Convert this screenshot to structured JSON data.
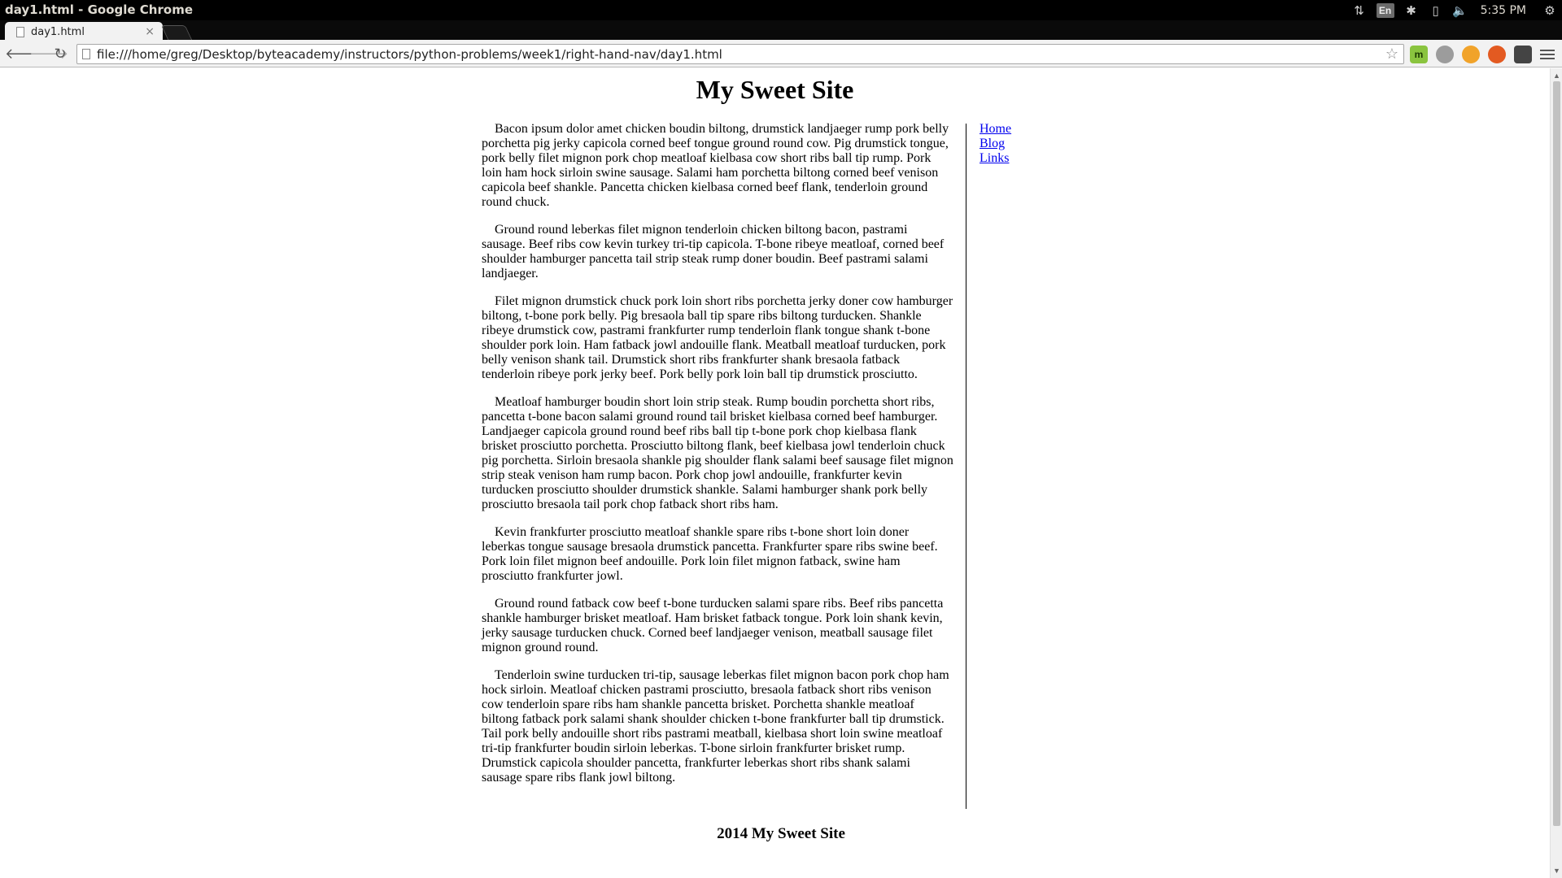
{
  "window": {
    "title": "day1.html - Google Chrome",
    "clock": "5:35 PM",
    "keyboard_layout": "En"
  },
  "browser": {
    "tab_title": "day1.html",
    "tab_close": "×",
    "url": "file:///home/greg/Desktop/byteacademy/instructors/python-problems/week1/right-hand-nav/day1.html",
    "back_icon": "🡐",
    "forward_icon": "🡒",
    "reload_icon": "↻",
    "bookmark_icon": "☆",
    "extensions": [
      "m",
      "",
      "",
      "",
      ""
    ]
  },
  "page": {
    "title": "My Sweet Site",
    "paragraphs": [
      "Bacon ipsum dolor amet chicken boudin biltong, drumstick landjaeger rump pork belly porchetta pig jerky capicola corned beef tongue ground round cow. Pig drumstick tongue, pork belly filet mignon pork chop meatloaf kielbasa cow short ribs ball tip rump. Pork loin ham hock sirloin swine sausage. Salami ham porchetta biltong corned beef venison capicola beef shankle. Pancetta chicken kielbasa corned beef flank, tenderloin ground round chuck.",
      "Ground round leberkas filet mignon tenderloin chicken biltong bacon, pastrami sausage. Beef ribs cow kevin turkey tri-tip capicola. T-bone ribeye meatloaf, corned beef shoulder hamburger pancetta tail strip steak rump doner boudin. Beef pastrami salami landjaeger.",
      "Filet mignon drumstick chuck pork loin short ribs porchetta jerky doner cow hamburger biltong, t-bone pork belly. Pig bresaola ball tip spare ribs biltong turducken. Shankle ribeye drumstick cow, pastrami frankfurter rump tenderloin flank tongue shank t-bone shoulder pork loin. Ham fatback jowl andouille flank. Meatball meatloaf turducken, pork belly venison shank tail. Drumstick short ribs frankfurter shank bresaola fatback tenderloin ribeye pork jerky beef. Pork belly pork loin ball tip drumstick prosciutto.",
      "Meatloaf hamburger boudin short loin strip steak. Rump boudin porchetta short ribs, pancetta t-bone bacon salami ground round tail brisket kielbasa corned beef hamburger. Landjaeger capicola ground round beef ribs ball tip t-bone pork chop kielbasa flank brisket prosciutto porchetta. Prosciutto biltong flank, beef kielbasa jowl tenderloin chuck pig porchetta. Sirloin bresaola shankle pig shoulder flank salami beef sausage filet mignon strip steak venison ham rump bacon. Pork chop jowl andouille, frankfurter kevin turducken prosciutto shoulder drumstick shankle. Salami hamburger shank pork belly prosciutto bresaola tail pork chop fatback short ribs ham.",
      "Kevin frankfurter prosciutto meatloaf shankle spare ribs t-bone short loin doner leberkas tongue sausage bresaola drumstick pancetta. Frankfurter spare ribs swine beef. Pork loin filet mignon beef andouille. Pork loin filet mignon fatback, swine ham prosciutto frankfurter jowl.",
      "Ground round fatback cow beef t-bone turducken salami spare ribs. Beef ribs pancetta shankle hamburger brisket meatloaf. Ham brisket fatback tongue. Pork loin shank kevin, jerky sausage turducken chuck. Corned beef landjaeger venison, meatball sausage filet mignon ground round.",
      "Tenderloin swine turducken tri-tip, sausage leberkas filet mignon bacon pork chop ham hock sirloin. Meatloaf chicken pastrami prosciutto, bresaola fatback short ribs venison cow tenderloin spare ribs ham shankle pancetta brisket. Porchetta shankle meatloaf biltong fatback pork salami shank shoulder chicken t-bone frankfurter ball tip drumstick. Tail pork belly andouille short ribs pastrami meatball, kielbasa short loin swine meatloaf tri-tip frankfurter boudin sirloin leberkas. T-bone sirloin frankfurter brisket rump. Drumstick capicola shoulder pancetta, frankfurter leberkas short ribs shank salami sausage spare ribs flank jowl biltong."
    ],
    "nav": [
      {
        "label": "Home"
      },
      {
        "label": "Blog"
      },
      {
        "label": "Links"
      }
    ],
    "footer": "2014 My Sweet Site"
  },
  "colors": {
    "link": "#0000ee",
    "panel": "#000000",
    "toolbar": "#f2f2f2"
  }
}
